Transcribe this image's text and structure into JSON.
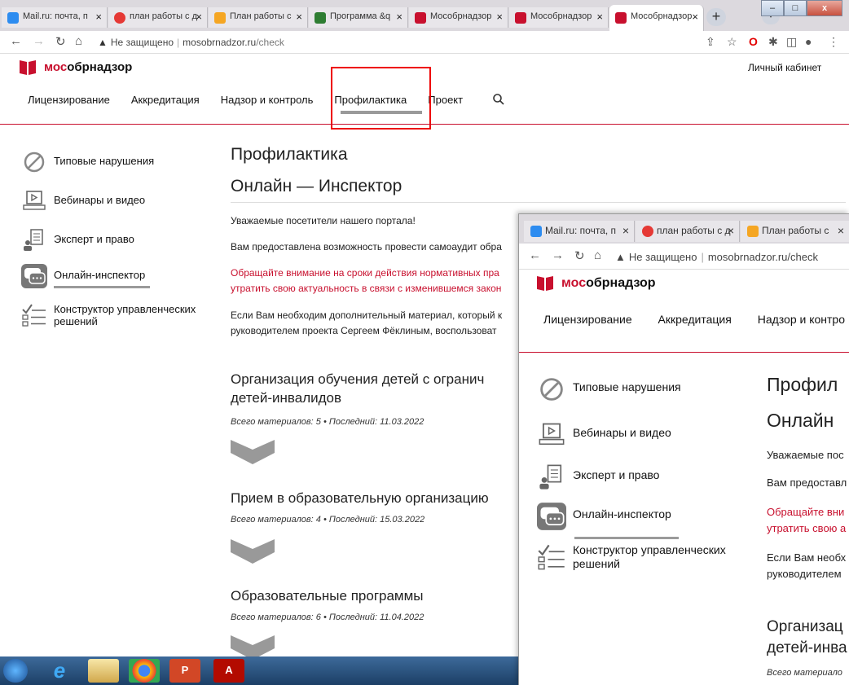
{
  "browser": {
    "tabs": [
      {
        "label": "Mail.ru: почта, п",
        "color": "#2d8cf0"
      },
      {
        "label": "план работы с д",
        "color": "#e53935"
      },
      {
        "label": "План работы с",
        "color": "#f5a623"
      },
      {
        "label": "Программа &q",
        "color": "#2e7d32"
      },
      {
        "label": "Мособрнадзор",
        "color": "#c8102e"
      },
      {
        "label": "Мособрнадзор",
        "color": "#c8102e"
      },
      {
        "label": "Мособрнадзор",
        "color": "#c8102e"
      }
    ],
    "url_warning": "Не защищено",
    "url_domain": "mosobrnadzor.ru",
    "url_path": "/check"
  },
  "site": {
    "logo_prefix": "мос",
    "logo_suffix": "обрнадзор",
    "cabinet": "Личный кабинет",
    "nav": [
      "Лицензирование",
      "Аккредитация",
      "Надзор и контроль",
      "Профилактика",
      "Проект"
    ]
  },
  "sidebar": {
    "items": [
      {
        "label": "Типовые нарушения",
        "icon": "forbidden-icon"
      },
      {
        "label": "Вебинары и видео",
        "icon": "laptop-play-icon"
      },
      {
        "label": "Эксперт и право",
        "icon": "expert-icon"
      },
      {
        "label": "Онлайн-инспектор",
        "icon": "chat-icon"
      },
      {
        "label": "Конструктор управленческих",
        "label2": "решений",
        "icon": "checklist-icon"
      }
    ]
  },
  "main": {
    "title": "Профилактика",
    "subtitle": "Онлайн — Инспектор",
    "p1": "Уважаемые посетители нашего портала!",
    "p2": "Вам предоставлена возможность провести самоаудит обра",
    "p3a": "Обращайте внимание на сроки действия нормативных пра",
    "p3b": "утратить свою актуальность в связи с изменившемся закон",
    "p4a": "Если Вам необходим дополнительный материал, который к",
    "p4b": "руководителем проекта Сергеем Фёклиным, воспользоват",
    "sections": [
      {
        "title": "Организация обучения детей с огранич",
        "title2": "детей-инвалидов",
        "meta": "Всего материалов: 5 • Последний: 11.03.2022"
      },
      {
        "title": "Прием в образовательную организацию",
        "meta": "Всего материалов: 4 • Последний: 15.03.2022"
      },
      {
        "title": "Образовательные программы",
        "meta": "Всего материалов: 6 • Последний: 11.04.2022"
      }
    ]
  },
  "window2": {
    "tabs": [
      {
        "label": "Mail.ru: почта, п",
        "color": "#2d8cf0"
      },
      {
        "label": "план работы с д",
        "color": "#e53935"
      },
      {
        "label": "План работы с",
        "color": "#f5a623"
      }
    ],
    "url_warning": "Не защищено",
    "url": "mosobrnadzor.ru/check",
    "nav": [
      "Лицензирование",
      "Аккредитация",
      "Надзор и контро"
    ],
    "h1": "Профил",
    "h2": "Онлайн",
    "p1": "Уважаемые пос",
    "p2": "Вам предоставл",
    "p3a": "Обращайте вни",
    "p3b": "утратить свою а",
    "p4a": "Если Вам необх",
    "p4b": "руководителем",
    "sec": "Организац",
    "sec2": "детей-инва",
    "meta": "Всего материало"
  }
}
